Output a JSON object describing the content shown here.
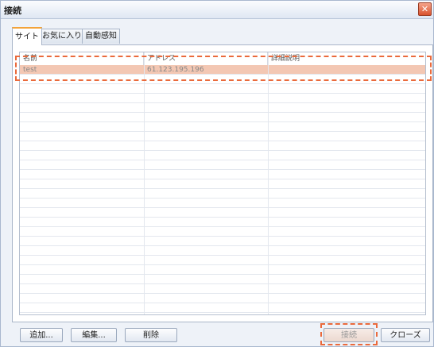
{
  "window": {
    "title": "接続",
    "close_icon": "close-icon"
  },
  "tabs": [
    {
      "label": "サイト"
    },
    {
      "label": "お気に入り"
    },
    {
      "label": "自動感知"
    }
  ],
  "list": {
    "columns": [
      "名前",
      "アドレス",
      "詳細説明"
    ],
    "rows": [
      {
        "name": "test",
        "address": "61.123.195.196",
        "description": ""
      }
    ]
  },
  "buttons": {
    "add": "追加...",
    "edit": "編集...",
    "delete": "削除",
    "connect": "接続",
    "close": "クローズ"
  },
  "highlight_color": "#ea6a3c"
}
